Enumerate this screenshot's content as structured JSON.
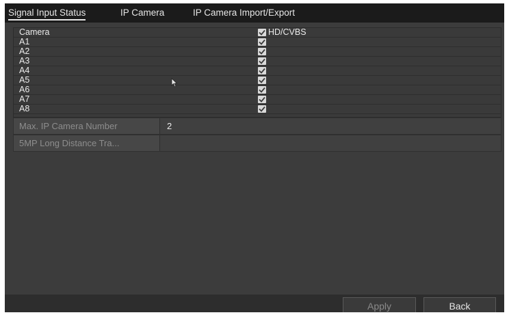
{
  "tabs": [
    {
      "label": "Signal Input Status",
      "active": true
    },
    {
      "label": "IP Camera",
      "active": false
    },
    {
      "label": "IP Camera Import/Export",
      "active": false
    }
  ],
  "table": {
    "header": {
      "camera": "Camera",
      "hd_cvbs": "HD/CVBS",
      "hd_cvbs_checked": true
    },
    "rows": [
      {
        "name": "A1",
        "checked": true
      },
      {
        "name": "A2",
        "checked": true
      },
      {
        "name": "A3",
        "checked": true
      },
      {
        "name": "A4",
        "checked": true
      },
      {
        "name": "A5",
        "checked": true
      },
      {
        "name": "A6",
        "checked": true
      },
      {
        "name": "A7",
        "checked": true
      },
      {
        "name": "A8",
        "checked": true
      }
    ]
  },
  "fields": {
    "max_ip_camera": {
      "label": "Max. IP Camera Number",
      "value": "2"
    },
    "long_distance": {
      "label": "5MP Long Distance Tra...",
      "value": ""
    }
  },
  "buttons": {
    "apply": "Apply",
    "back": "Back"
  },
  "colors": {
    "background": "#3c3c3c",
    "tab_bar": "#1b1b1b",
    "checkbox": "#d9d9d9"
  },
  "icons": {
    "checkbox": "checkmark-icon",
    "pointer": "mouse-pointer-icon"
  }
}
